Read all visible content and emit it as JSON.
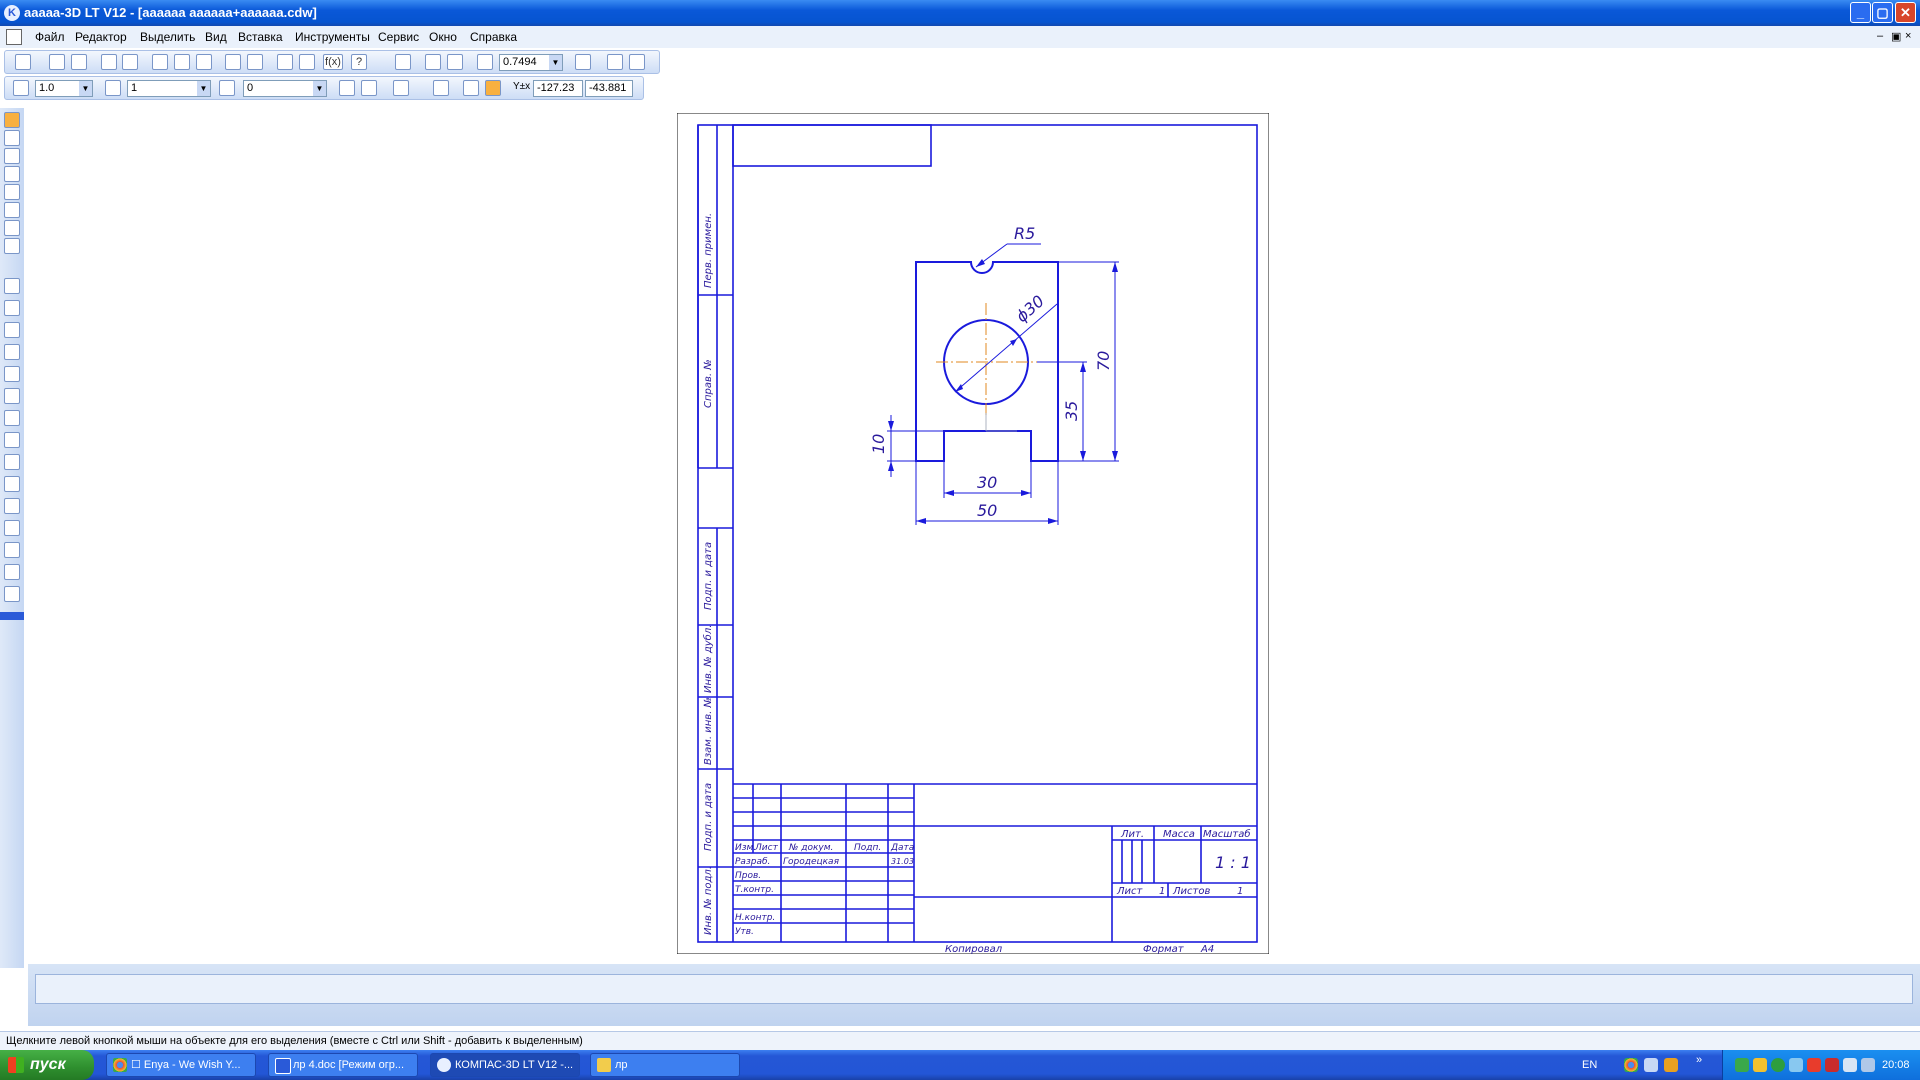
{
  "window": {
    "title": "ааааа-3D LT V12 - [аааааа аааааа+аааааа.cdw]",
    "buttons": {
      "minimize": "_",
      "maximize": "▢",
      "close": "✕"
    }
  },
  "menu": {
    "items": [
      "Файл",
      "Редактор",
      "Выделить",
      "Вид",
      "Вставка",
      "Инструменты",
      "Сервис",
      "Окно",
      "Справка"
    ],
    "mdi": {
      "minimize": "–",
      "restore": "▣",
      "close": "×"
    }
  },
  "toolbar": {
    "zoom_value": "0.7494",
    "step_value": "1.0",
    "layer_value": "1",
    "style_value": "0",
    "coord_x": "-127.23",
    "coord_y": "-43.881",
    "coord_label": "Y±x"
  },
  "drawing": {
    "stamps": {
      "perv_primen": "Перв. примен.",
      "sprav_no": "Справ. №",
      "podp_data_1": "Подп. и дата",
      "inv_dubl": "Инв. № дубл.",
      "vzam_inv": "Взам. инв. №",
      "podp_data_2": "Подп. и дата",
      "inv_podl": "Инв. № подл."
    },
    "dimensions": {
      "radius": "R5",
      "diameter": "ϕ30",
      "height_total": "70",
      "height_center": "35",
      "slot_depth": "10",
      "slot_width": "30",
      "width_total": "50"
    },
    "title_block": {
      "headers": [
        "Изм.",
        "Лист",
        "№ докум.",
        "Подп.",
        "Дата"
      ],
      "rows": {
        "razrab": "Разраб.",
        "razrab_name": "Городецкая",
        "razrab_date": "31.03",
        "prov": "Пров.",
        "tkontr": "Т.контр.",
        "nkontr": "Н.контр.",
        "utv": "Утв."
      },
      "lit": "Лит.",
      "massa": "Масса",
      "masshtab": "Масштаб",
      "scale_value": "1 : 1",
      "list_label": "Лист",
      "list_value": "1",
      "listov_label": "Листов",
      "listov_value": "1",
      "kopiroval": "Копировал",
      "format_label": "Формат",
      "format_value": "А4"
    }
  },
  "status": {
    "hint": "Щелкните левой кнопкой мыши на объекте для его выделения (вместе с Ctrl или Shift - добавить к выделенным)"
  },
  "taskbar": {
    "start": "пуск",
    "tasks": [
      {
        "label": "☐ Enya - We Wish Y...",
        "icon": "chrome-icon"
      },
      {
        "label": "лр 4.doc [Режим огр...",
        "icon": "word-icon"
      },
      {
        "label": "КОМПАС-3D LT V12 -...",
        "icon": "kompas-icon"
      },
      {
        "label": "лр",
        "icon": "folder-icon"
      }
    ],
    "language": "EN",
    "clock": "20:08",
    "chevron": "»"
  },
  "colors": {
    "drawing_line": "#1a1adc",
    "axis_line": "#e08a20",
    "titlebar": "#0a58d8",
    "taskbar": "#2457d6"
  }
}
